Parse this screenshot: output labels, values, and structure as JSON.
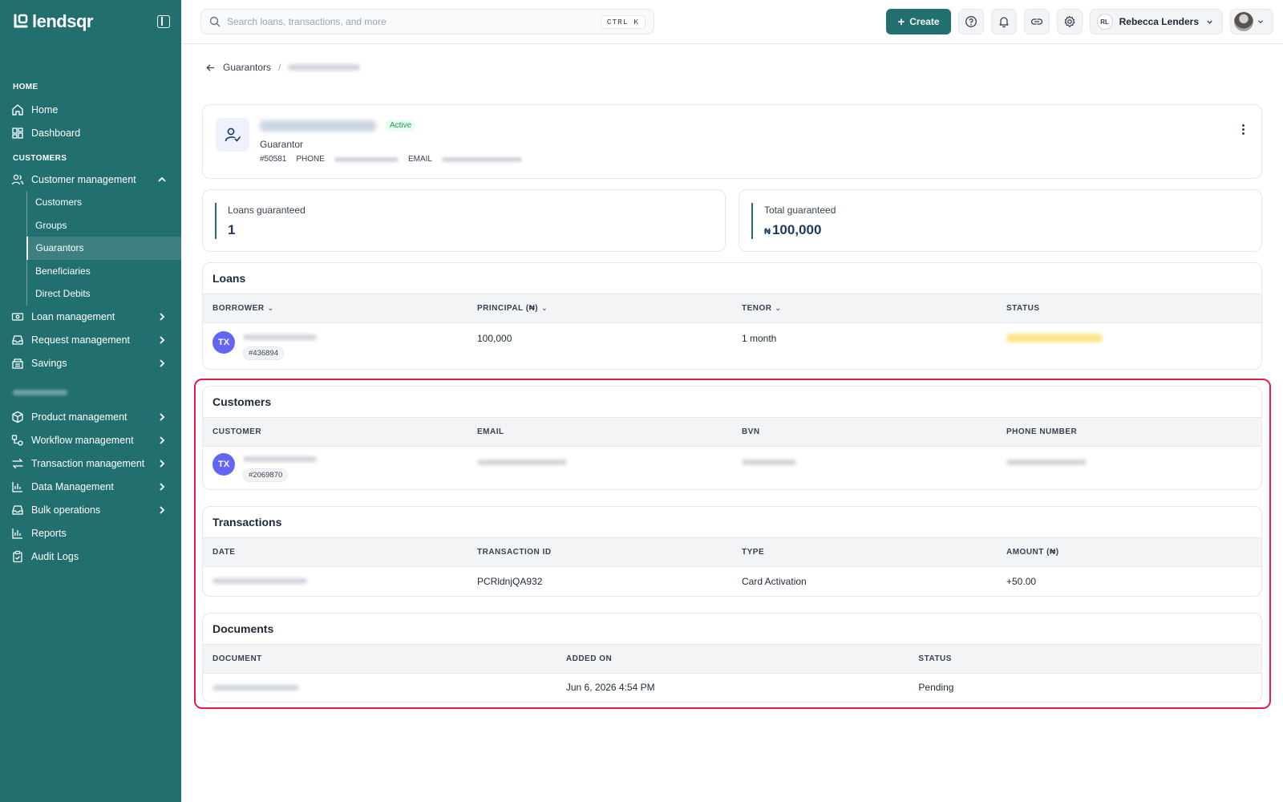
{
  "brand": {
    "name": "lendsqr"
  },
  "sidebar": {
    "sections": {
      "home": "HOME",
      "customers": "CUSTOMERS"
    },
    "home_items": [
      {
        "label": "Home",
        "icon": "house-icon"
      },
      {
        "label": "Dashboard",
        "icon": "grid-icon"
      }
    ],
    "customer_management": {
      "label": "Customer management",
      "icon": "users-icon"
    },
    "sub_items": [
      "Customers",
      "Groups",
      "Guarantors",
      "Beneficiaries",
      "Direct Debits"
    ],
    "active_sub_item": "Guarantors",
    "group_items": [
      {
        "label": "Loan management",
        "icon": "banknote-icon"
      },
      {
        "label": "Request management",
        "icon": "inbox-icon"
      },
      {
        "label": "Savings",
        "icon": "piggybank-icon"
      }
    ],
    "business_items": [
      {
        "label": "Product management",
        "icon": "box-icon"
      },
      {
        "label": "Workflow management",
        "icon": "workflow-icon"
      },
      {
        "label": "Transaction management",
        "icon": "arrows-icon"
      },
      {
        "label": "Data Management",
        "icon": "bar-chart-icon"
      },
      {
        "label": "Bulk operations",
        "icon": "inbox-icon"
      }
    ],
    "bottom_items": [
      {
        "label": "Reports",
        "icon": "bar-chart-icon"
      },
      {
        "label": "Audit Logs",
        "icon": "clipboard-icon"
      }
    ]
  },
  "topbar": {
    "search_placeholder": "Search loans, transactions, and more",
    "shortcut": "CTRL K",
    "create_label": "Create",
    "user_initials": "RL",
    "user_name": "Rebecca Lenders"
  },
  "breadcrumb": {
    "parent": "Guarantors",
    "separator": "/"
  },
  "profile": {
    "status": "Active",
    "role": "Guarantor",
    "id": "#50581",
    "phone_label": "PHONE",
    "email_label": "EMAIL"
  },
  "stats": {
    "loans_guaranteed_label": "Loans guaranteed",
    "loans_guaranteed_value": "1",
    "total_guaranteed_label": "Total guaranteed",
    "total_guaranteed_currency": "₦",
    "total_guaranteed_value": "100,000"
  },
  "loans": {
    "title": "Loans",
    "headers": [
      "BORROWER",
      "PRINCIPAL (₦)",
      "TENOR",
      "STATUS"
    ],
    "rows": [
      {
        "initials": "TX",
        "id": "#436894",
        "principal": "100,000",
        "tenor": "1 month"
      }
    ]
  },
  "customers": {
    "title": "Customers",
    "headers": [
      "CUSTOMER",
      "EMAIL",
      "BVN",
      "PHONE NUMBER"
    ],
    "rows": [
      {
        "initials": "TX",
        "id": "#2069870"
      }
    ]
  },
  "transactions": {
    "title": "Transactions",
    "headers": [
      "DATE",
      "TRANSACTION ID",
      "TYPE",
      "AMOUNT (₦)"
    ],
    "rows": [
      {
        "transaction_id": "PCRldnjQA932",
        "type": "Card Activation",
        "amount": "+50.00"
      }
    ]
  },
  "documents": {
    "title": "Documents",
    "headers": [
      "DOCUMENT",
      "ADDED ON",
      "STATUS"
    ],
    "rows": [
      {
        "added_on": "Jun 6, 2026 4:54 PM",
        "status": "Pending"
      }
    ]
  }
}
